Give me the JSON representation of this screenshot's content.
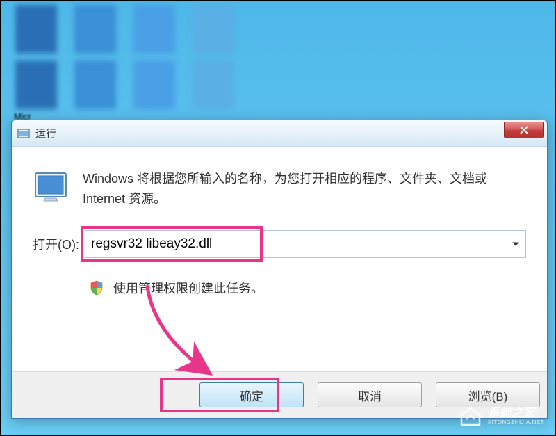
{
  "desktop": {
    "partial_label": "Micr"
  },
  "dialog": {
    "title": "运行",
    "description": "Windows 将根据您所输入的名称，为您打开相应的程序、文件夹、文档或 Internet 资源。",
    "open_label": "打开(O):",
    "command_value": "regsvr32 libeay32.dll",
    "admin_text": "使用管理权限创建此任务。",
    "buttons": {
      "ok": "确定",
      "cancel": "取消",
      "browse": "浏览(B)"
    }
  },
  "watermark": {
    "cn": "系统之家",
    "en": "XITONGZHIJIA.NET"
  },
  "colors": {
    "highlight": "#e8358a"
  }
}
